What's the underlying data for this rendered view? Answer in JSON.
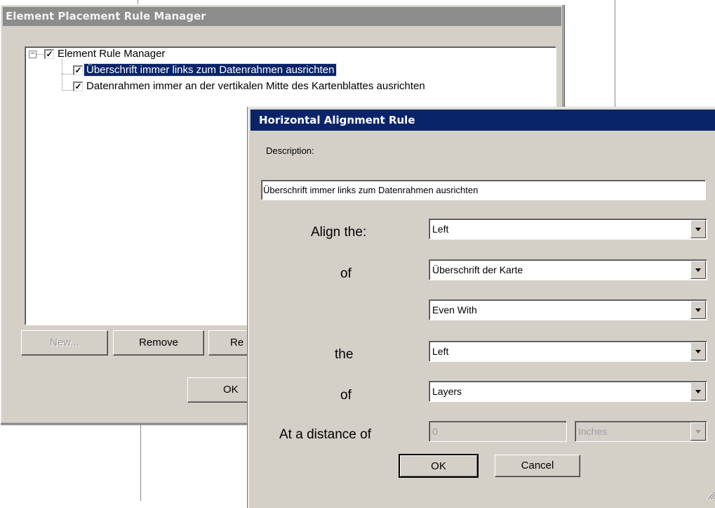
{
  "manager_dialog": {
    "title": "Element Placement Rule Manager",
    "tree": {
      "root": {
        "label": "Element Rule Manager",
        "expander": "⊟",
        "checked": true
      },
      "children": [
        {
          "label": "Überschrift immer links zum Datenrahmen ausrichten",
          "checked": true,
          "selected": true
        },
        {
          "label": "Datenrahmen immer an der vertikalen Mitte des Kartenblattes ausrichten",
          "checked": true,
          "selected": false
        }
      ]
    },
    "buttons": {
      "new": "New...",
      "remove": "Remove",
      "rename_partial": "Re",
      "ok": "OK"
    }
  },
  "rule_dialog": {
    "title": "Horizontal Alignment Rule",
    "description_label": "Description:",
    "description_value": "Überschrift immer links zum Datenrahmen ausrichten",
    "rows": {
      "align_label": "Align the:",
      "align_value": "Left",
      "of1_label": "of",
      "of1_value": "Überschrift der Karte",
      "relation_value": "Even With",
      "the_label": "the",
      "the_value": "Left",
      "of2_label": "of",
      "of2_value": "Layers",
      "distance_label": "At a distance of",
      "distance_value": "0",
      "units_value": "Inches"
    },
    "buttons": {
      "ok": "OK",
      "cancel": "Cancel"
    }
  },
  "colors": {
    "active_title": "#0a246a",
    "inactive_title": "#8c8c8c",
    "face": "#d4d0c8",
    "selection": "#0a246a"
  },
  "icons": [
    "checkbox-checked-icon",
    "tree-collapse-icon",
    "dropdown-arrow-icon",
    "resize-grip-icon"
  ]
}
